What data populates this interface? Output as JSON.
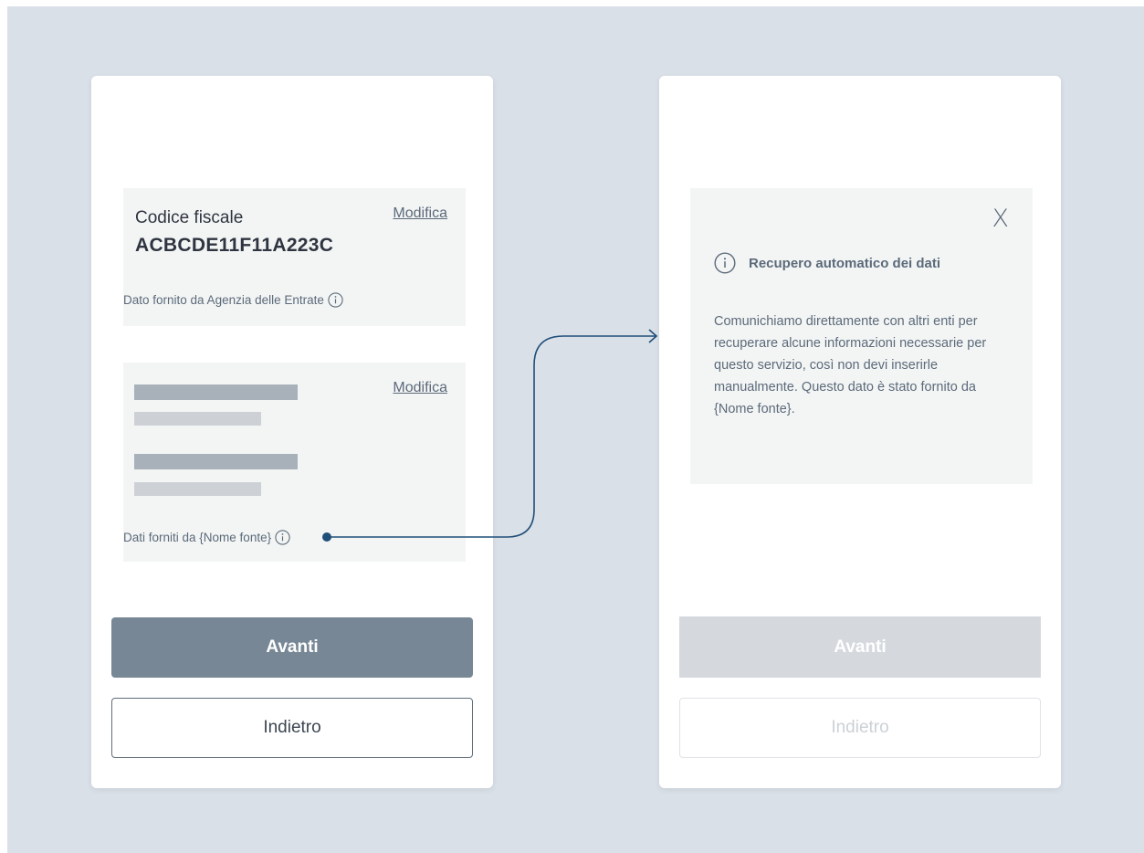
{
  "left_screen": {
    "card1": {
      "label": "Codice fiscale",
      "value": "ACBCDE11F11A223C",
      "edit_label": "Modifica",
      "source_text": "Dato fornito da Agenzia delle Entrate"
    },
    "card2": {
      "edit_label": "Modifica",
      "source_text": "Dati forniti da {Nome fonte}"
    },
    "primary_button": "Avanti",
    "secondary_button": "Indietro"
  },
  "right_screen": {
    "modal": {
      "close_label": "X",
      "title": "Recupero automatico dei dati",
      "body": "Comunichiamo direttamente con altri enti per recuperare alcune informazioni necessarie per questo servizio, così non devi inserirle manualmente. Questo dato è stato fornito da {Nome fonte}."
    },
    "primary_button": "Avanti",
    "secondary_button": "Indietro"
  },
  "colors": {
    "background": "#dae0e7",
    "connector": "#1f4e79",
    "primary_button": "#778795",
    "disabled_button": "#d5d9de"
  },
  "icons": [
    "info-icon",
    "close-icon",
    "arrow-icon"
  ]
}
